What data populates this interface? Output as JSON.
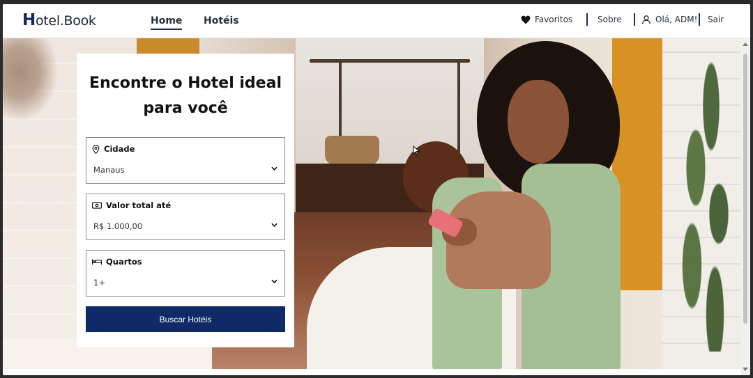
{
  "header": {
    "logo_initial": "H",
    "logo_rest": "otel.Book",
    "nav": {
      "home": "Home",
      "hoteis": "Hotéis"
    },
    "favoritos": "Favoritos",
    "sobre": "Sobre",
    "user_greeting": "Olá, ADM!",
    "sair": "Sair"
  },
  "search_card": {
    "title_line1": "Encontre o Hotel ideal",
    "title_line2": "para você",
    "fields": [
      {
        "label": "Cidade",
        "value": "Manaus",
        "icon": "map-pin-icon"
      },
      {
        "label": "Valor total até",
        "value": "R$ 1.000,00",
        "icon": "money-icon"
      },
      {
        "label": "Quartos",
        "value": "1+",
        "icon": "bed-icon"
      }
    ],
    "button_label": "Buscar Hotéis"
  },
  "colors": {
    "brand_navy": "#0f2a66",
    "accent_orange": "#d79223"
  }
}
